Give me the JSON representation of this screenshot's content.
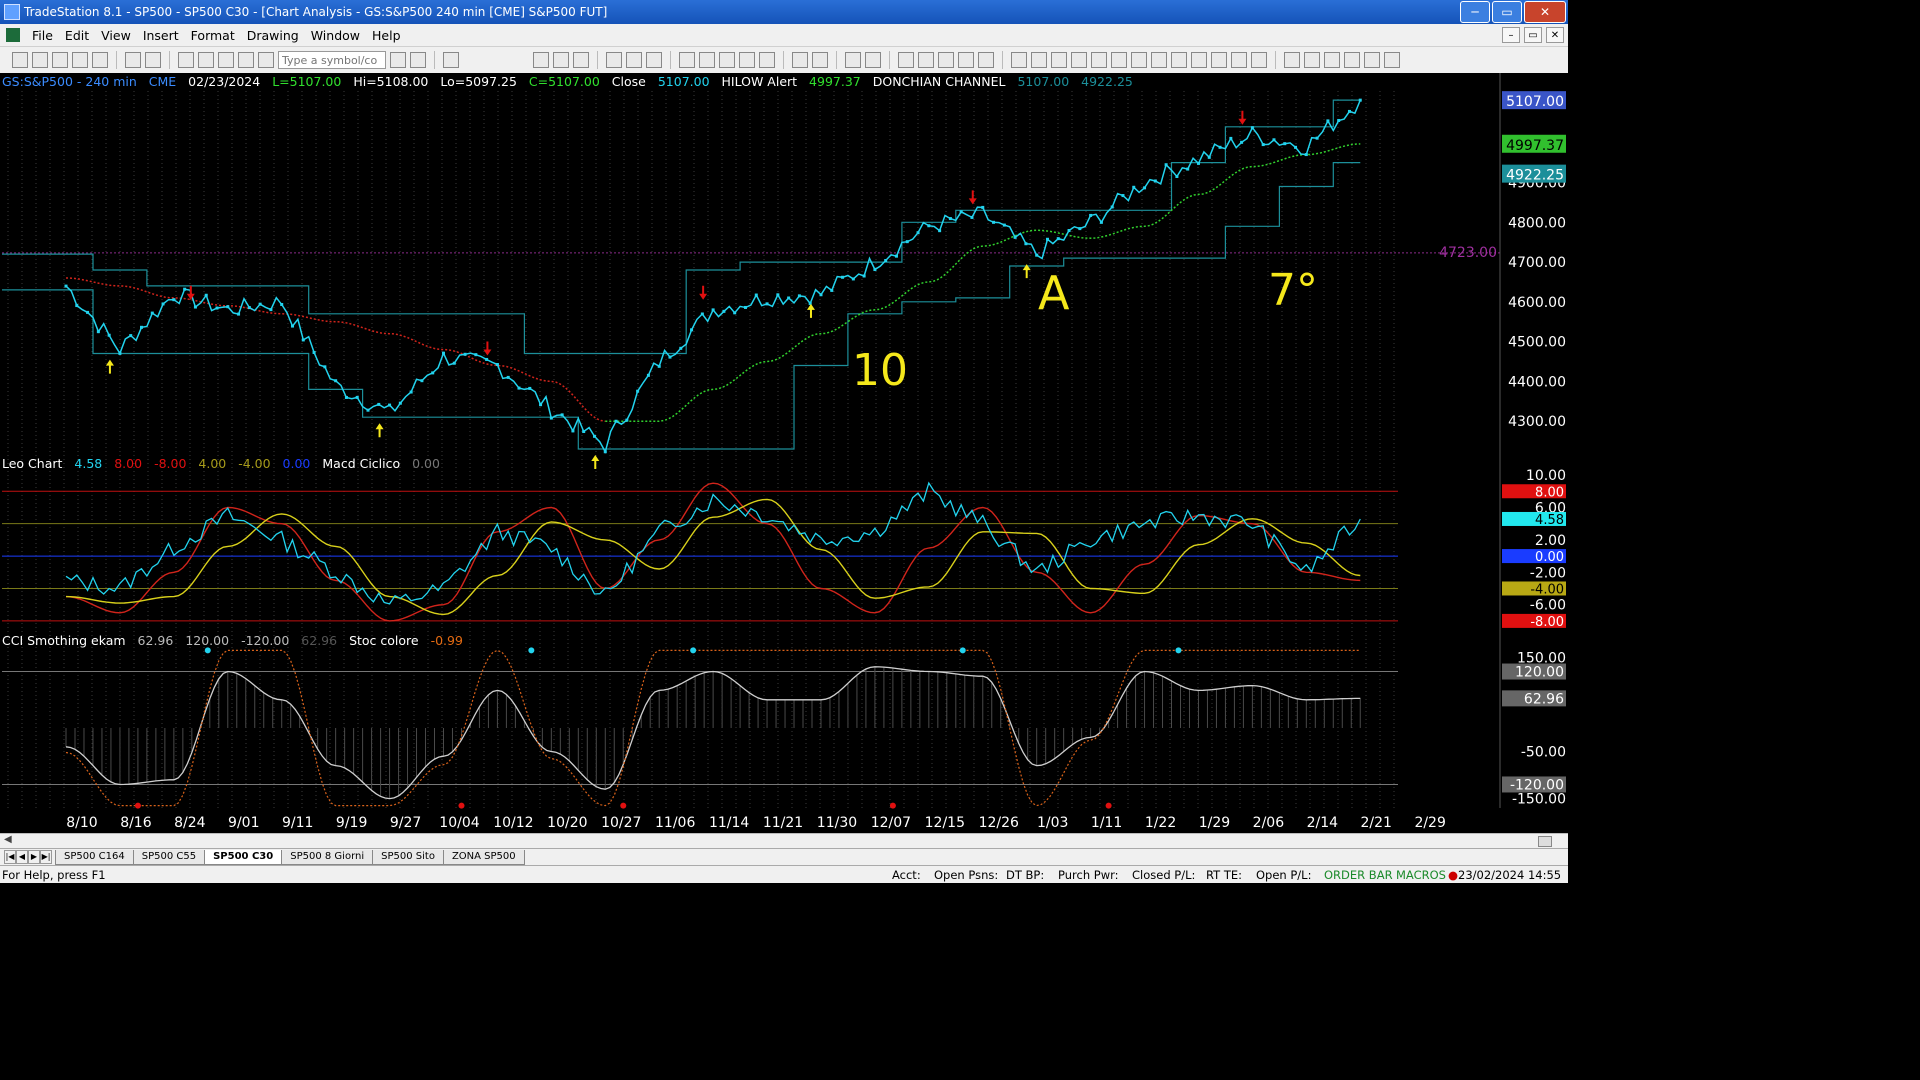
{
  "window": {
    "title": "TradeStation 8.1 - SP500 - SP500 C30 - [Chart Analysis - GS:S&P500  240 min  [CME] S&P500 FUT]",
    "buttons": {
      "minimize": "─",
      "maximize": "▭",
      "close": "✕"
    }
  },
  "menu": {
    "items": [
      "File",
      "Edit",
      "View",
      "Insert",
      "Format",
      "Drawing",
      "Window",
      "Help"
    ],
    "mdi_buttons": [
      "–",
      "▭",
      "✕"
    ]
  },
  "toolbar": {
    "symbol_placeholder": "Type a symbol/co"
  },
  "header_line": {
    "symbol": "GS:S&P500 - 240 min",
    "exchange": "CME",
    "date": "02/23/2024",
    "last": "L=5107.00",
    "hi": "Hi=5108.00",
    "lo": "Lo=5097.25",
    "close_val": "C=5107.00",
    "close_label": "Close",
    "close_num": "5107.00",
    "hilow_label": "HILOW Alert",
    "hilow_val": "4997.37",
    "donchian_label": "DONCHIAN CHANNEL",
    "donchian_upper": "5107.00",
    "donchian_lower": "4922.25"
  },
  "leo_line": {
    "name": "Leo Chart",
    "v1": "4.58",
    "v2": "8.00",
    "v3": "-8.00",
    "v4": "4.00",
    "v5": "-4.00",
    "v6": "0.00",
    "macd_label": "Macd Ciclico",
    "macd_val": "0.00"
  },
  "cci_line": {
    "name": "CCI Smothing ekam",
    "v1": "62.96",
    "v2": "120.00",
    "v3": "-120.00",
    "v4": "62.96",
    "stoc_label": "Stoc colore",
    "stoc_val": "-0.99"
  },
  "price_axis": {
    "ticks": [
      "5107.00",
      "4900.00",
      "4800.00",
      "4700.00",
      "4600.00",
      "4500.00",
      "4400.00",
      "4300.00"
    ],
    "badges": [
      "5107.00",
      "4997.37",
      "4922.25"
    ],
    "hline_label": "4723.00"
  },
  "leo_axis": {
    "ticks": [
      "10.00",
      "6.00",
      "2.00",
      "-2.00",
      "-6.00"
    ],
    "badges": [
      "8.00",
      "4.58",
      "0.00",
      "-4.00",
      "-8.00"
    ]
  },
  "cci_axis": {
    "ticks": [
      "150.00",
      "-50.00",
      "-150.00"
    ],
    "badges": [
      "120.00",
      "62.96",
      "-120.00"
    ]
  },
  "date_axis": [
    "8/10",
    "8/16",
    "8/24",
    "9/01",
    "9/11",
    "9/19",
    "9/27",
    "10/04",
    "10/12",
    "10/20",
    "10/27",
    "11/06",
    "11/14",
    "11/21",
    "11/30",
    "12/07",
    "12/15",
    "12/26",
    "1/03",
    "1/11",
    "1/22",
    "1/29",
    "2/06",
    "2/14",
    "2/21",
    "2/29"
  ],
  "annotations": {
    "a1": "10",
    "a2": "A",
    "a3": "7°"
  },
  "tabs": [
    "SP500 C164",
    "SP500 C55",
    "SP500 C30",
    "SP500 8 Giorni",
    "SP500 Sito",
    "ZONA SP500"
  ],
  "active_tab": "SP500 C30",
  "status": {
    "help": "For Help, press F1",
    "acct": "Acct:",
    "open_psns": "Open Psns:",
    "dt_bp": "DT BP:",
    "purch_pwr": "Purch Pwr:",
    "closed_pl": "Closed P/L:",
    "rt_te": "RT TE:",
    "open_pl": "Open P/L:",
    "order_bar": "ORDER BAR",
    "macros": "MACROS",
    "datetime": "23/02/2024 14:55"
  },
  "chart_data": [
    {
      "type": "line",
      "x": [
        "8/10",
        "8/16",
        "8/24",
        "9/01",
        "9/11",
        "9/19",
        "9/27",
        "10/04",
        "10/12",
        "10/20",
        "10/27",
        "11/06",
        "11/14",
        "11/21",
        "11/30",
        "12/07",
        "12/15",
        "12/26",
        "1/03",
        "1/11",
        "1/22",
        "1/29",
        "2/06",
        "2/14",
        "2/21"
      ],
      "series": [
        {
          "name": "Close",
          "values": [
            4640,
            4480,
            4620,
            4580,
            4600,
            4390,
            4320,
            4460,
            4440,
            4330,
            4240,
            4450,
            4580,
            4610,
            4620,
            4700,
            4790,
            4820,
            4720,
            4800,
            4900,
            4960,
            5020,
            4990,
            5107
          ]
        },
        {
          "name": "HILOW Alert",
          "values": [
            4660,
            4640,
            4610,
            4590,
            4570,
            4550,
            4520,
            4480,
            4440,
            4400,
            4300,
            4300,
            4380,
            4450,
            4520,
            4580,
            4650,
            4740,
            4780,
            4760,
            4790,
            4870,
            4940,
            4970,
            4997
          ]
        },
        {
          "name": "DONCHIAN CHANNEL",
          "values": [
            4720,
            4680,
            4640,
            4640,
            4640,
            4570,
            4570,
            4570,
            4570,
            4470,
            4470,
            4470,
            4680,
            4700,
            4700,
            4700,
            4800,
            4830,
            4830,
            4830,
            4830,
            4950,
            5040,
            5040,
            5107
          ]
        }
      ],
      "ylim": [
        4220,
        5130
      ]
    },
    {
      "type": "line",
      "x": [
        "8/10",
        "8/16",
        "8/24",
        "9/01",
        "9/11",
        "9/19",
        "9/27",
        "10/04",
        "10/12",
        "10/20",
        "10/27",
        "11/06",
        "11/14",
        "11/21",
        "11/30",
        "12/07",
        "12/15",
        "12/26",
        "1/03",
        "1/11",
        "1/22",
        "1/29",
        "2/06",
        "2/14",
        "2/21"
      ],
      "series": [
        {
          "name": "Leo Chart",
          "values": [
            -3,
            -4,
            1,
            5,
            2,
            -2,
            -6,
            -4,
            3,
            1,
            -5,
            3,
            7,
            5,
            2,
            3,
            8,
            4,
            -2,
            2,
            4,
            5,
            4,
            -2,
            4.58
          ]
        },
        {
          "name": "Macd Ciclico",
          "values": [
            -5,
            -7,
            -2,
            6,
            4,
            -3,
            -8,
            -6,
            3,
            6,
            -4,
            2,
            9,
            4,
            -4,
            -7,
            1,
            6,
            -2,
            -7,
            -1,
            5,
            4,
            -2,
            -3
          ]
        }
      ],
      "ylim": [
        -9,
        10.5
      ]
    },
    {
      "type": "line",
      "x": [
        "8/10",
        "8/16",
        "8/24",
        "9/01",
        "9/11",
        "9/19",
        "9/27",
        "10/04",
        "10/12",
        "10/20",
        "10/27",
        "11/06",
        "11/14",
        "11/21",
        "11/30",
        "12/07",
        "12/15",
        "12/26",
        "1/03",
        "1/11",
        "1/22",
        "1/29",
        "2/06",
        "2/14",
        "2/21"
      ],
      "series": [
        {
          "name": "CCI Smothing ekam",
          "values": [
            -40,
            -120,
            -110,
            120,
            60,
            -80,
            -150,
            -60,
            80,
            -50,
            -130,
            80,
            120,
            60,
            60,
            130,
            120,
            110,
            -80,
            -20,
            120,
            80,
            90,
            60,
            62.96
          ]
        }
      ],
      "ylim": [
        -170,
        170
      ]
    }
  ]
}
